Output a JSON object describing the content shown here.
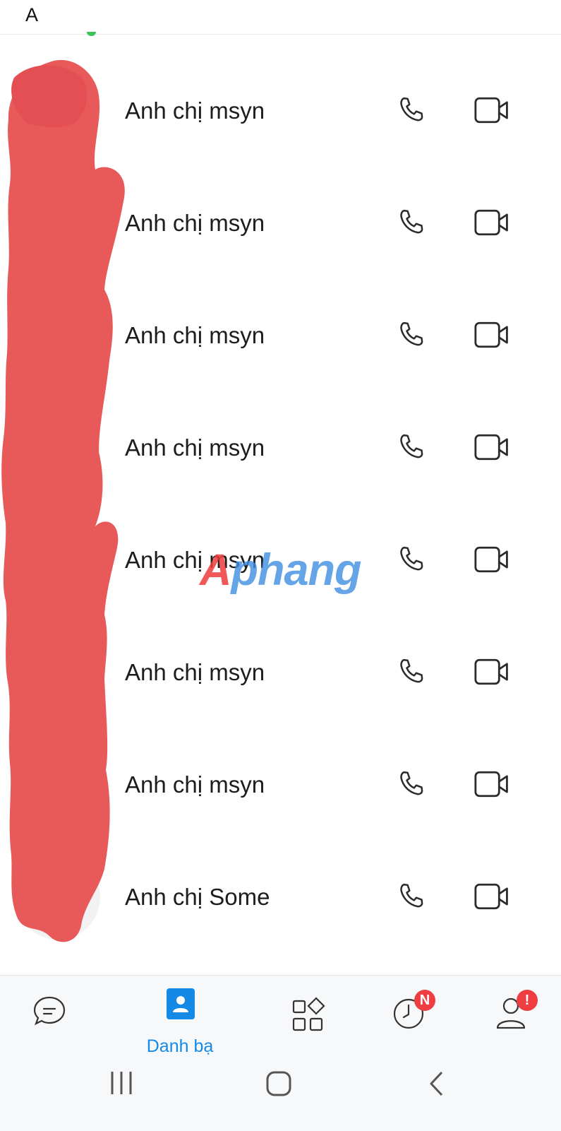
{
  "section": {
    "letter": "A"
  },
  "contacts": [
    {
      "name": "Anh chị msyn"
    },
    {
      "name": "Anh chị msyn"
    },
    {
      "name": "Anh chị msyn"
    },
    {
      "name": "Anh chị msyn"
    },
    {
      "name": "Anh chị msyn"
    },
    {
      "name": "Anh chị msyn"
    },
    {
      "name": "Anh chị msyn"
    },
    {
      "name": "Anh chị Some"
    }
  ],
  "contact_actions": {
    "call_icon": "phone-icon",
    "video_icon": "video-camera-icon"
  },
  "watermark": {
    "first_letter": "A",
    "rest": "phang"
  },
  "bottom_nav": {
    "items": [
      {
        "id": "messages",
        "icon": "chat-bubble-icon",
        "label": ""
      },
      {
        "id": "contacts",
        "icon": "contact-card-icon",
        "label": "Danh bạ",
        "active": true
      },
      {
        "id": "discover",
        "icon": "apps-grid-icon",
        "label": ""
      },
      {
        "id": "timeline",
        "icon": "clock-icon",
        "label": "",
        "badge": "N"
      },
      {
        "id": "profile",
        "icon": "person-icon",
        "label": "",
        "badge": "!"
      }
    ]
  },
  "system_nav": {
    "items": [
      "recent-apps-icon",
      "home-icon",
      "back-icon"
    ]
  },
  "colors": {
    "accent": "#1589e6",
    "badge": "#ef3e42",
    "redaction": "#e85a5a",
    "online": "#3ec25a"
  }
}
